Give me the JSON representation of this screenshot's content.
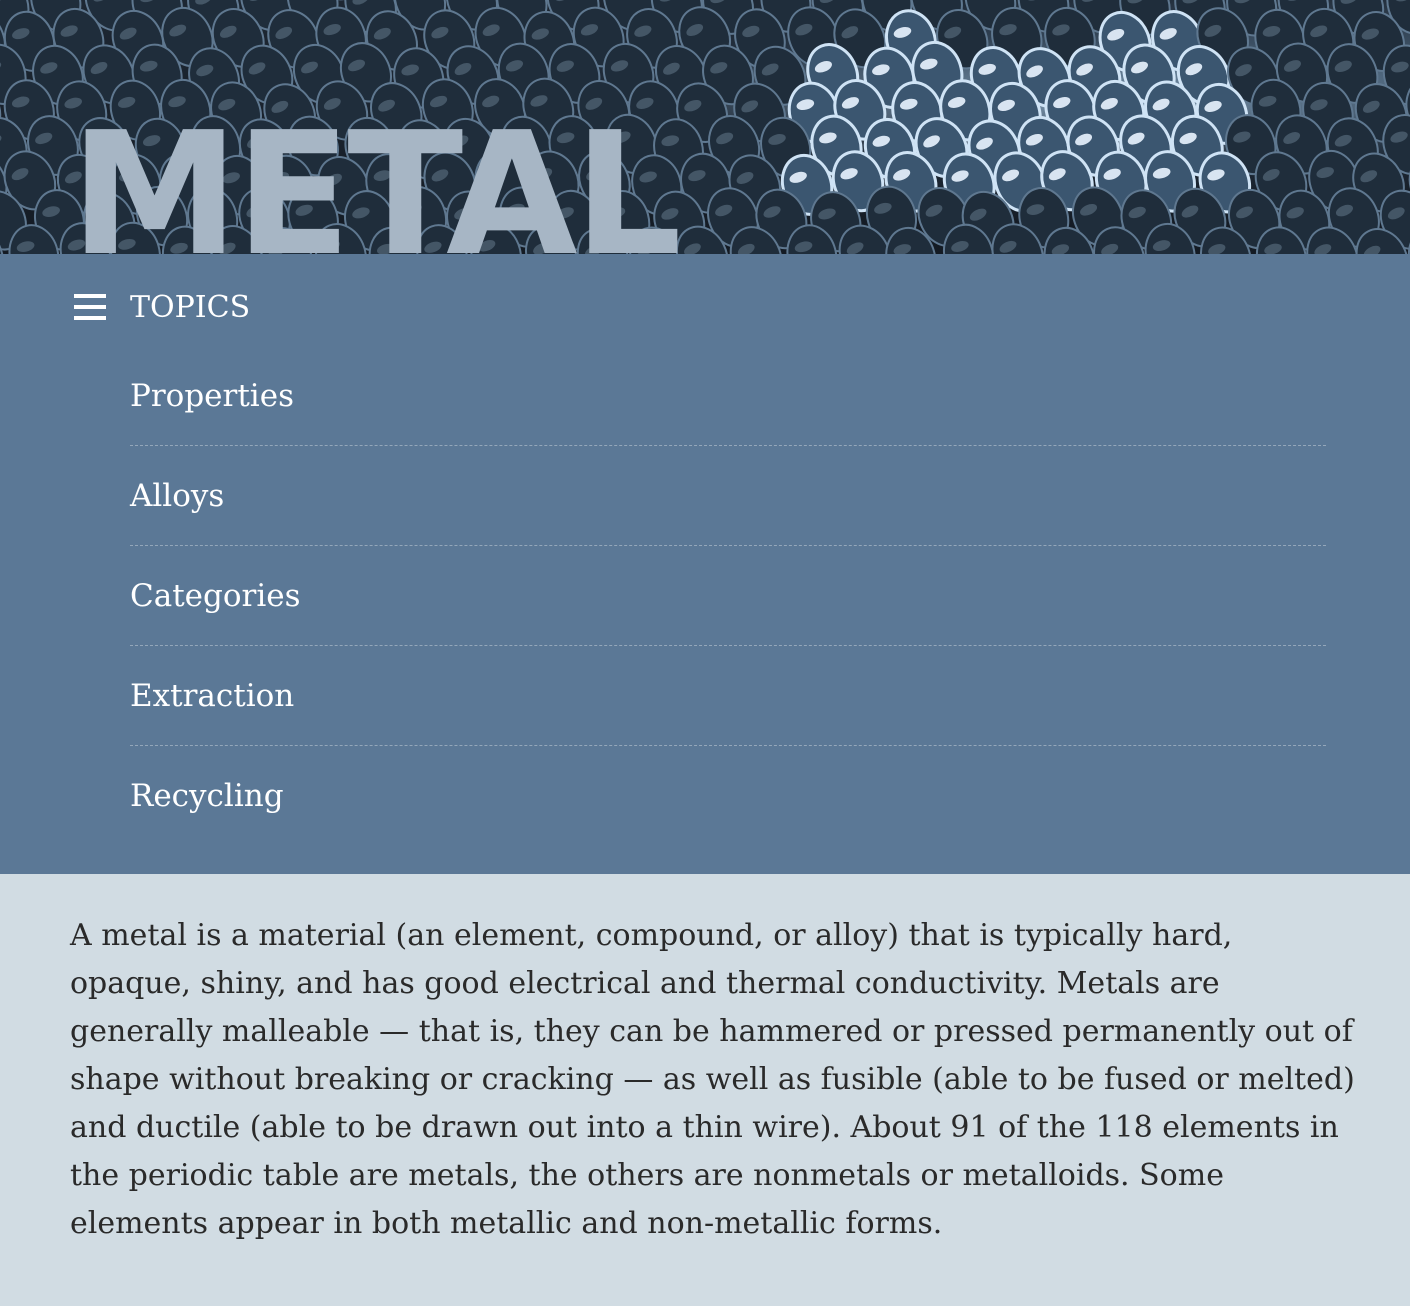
{
  "hero": {
    "title": "METAL"
  },
  "topics": {
    "header_label": "TOPICS",
    "items": [
      {
        "label": "Properties"
      },
      {
        "label": "Alloys"
      },
      {
        "label": "Categories"
      },
      {
        "label": "Extraction"
      },
      {
        "label": "Recycling"
      }
    ]
  },
  "article": {
    "paragraph": "A metal is a material (an element, compound, or alloy) that is typically hard, opaque, shiny, and has good electrical and thermal conductivity. Metals are generally malleable — that is, they can be hammered or pressed permanently out of shape without breaking or cracking — as well as fusible (able to be fused or melted) and ductile (able to be drawn out into a thin wire). About 91 of the 118 elements in the periodic table are metals, the others are nonmetals or metalloids. Some elements appear in both metallic and non-metallic forms."
  },
  "colors": {
    "topics_background": "#5b7896",
    "page_background": "#d1dce3",
    "hero_title": "#a7b6c5",
    "body_text": "#2a2a2a"
  },
  "icons": {
    "menu": "hamburger-menu-icon"
  }
}
